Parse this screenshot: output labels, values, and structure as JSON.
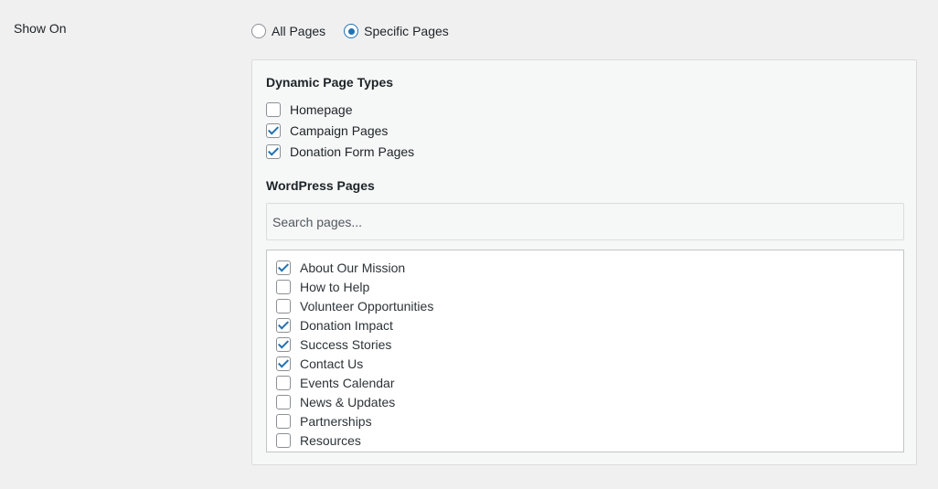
{
  "show_on": {
    "label": "Show On",
    "options": [
      {
        "label": "All Pages",
        "selected": false
      },
      {
        "label": "Specific Pages",
        "selected": true
      }
    ]
  },
  "dynamic_page_types": {
    "heading": "Dynamic Page Types",
    "items": [
      {
        "label": "Homepage",
        "checked": false
      },
      {
        "label": "Campaign Pages",
        "checked": true
      },
      {
        "label": "Donation Form Pages",
        "checked": true
      }
    ]
  },
  "wordpress_pages": {
    "heading": "WordPress Pages",
    "search_placeholder": "Search pages...",
    "items": [
      {
        "label": "About Our Mission",
        "checked": true
      },
      {
        "label": "How to Help",
        "checked": false
      },
      {
        "label": "Volunteer Opportunities",
        "checked": false
      },
      {
        "label": "Donation Impact",
        "checked": true
      },
      {
        "label": "Success Stories",
        "checked": true
      },
      {
        "label": "Contact Us",
        "checked": true
      },
      {
        "label": "Events Calendar",
        "checked": false
      },
      {
        "label": "News & Updates",
        "checked": false
      },
      {
        "label": "Partnerships",
        "checked": false
      },
      {
        "label": "Resources",
        "checked": false
      }
    ]
  },
  "colors": {
    "accent": "#2271b1",
    "background": "#f0f0f1",
    "panel": "#f6f7f7"
  }
}
